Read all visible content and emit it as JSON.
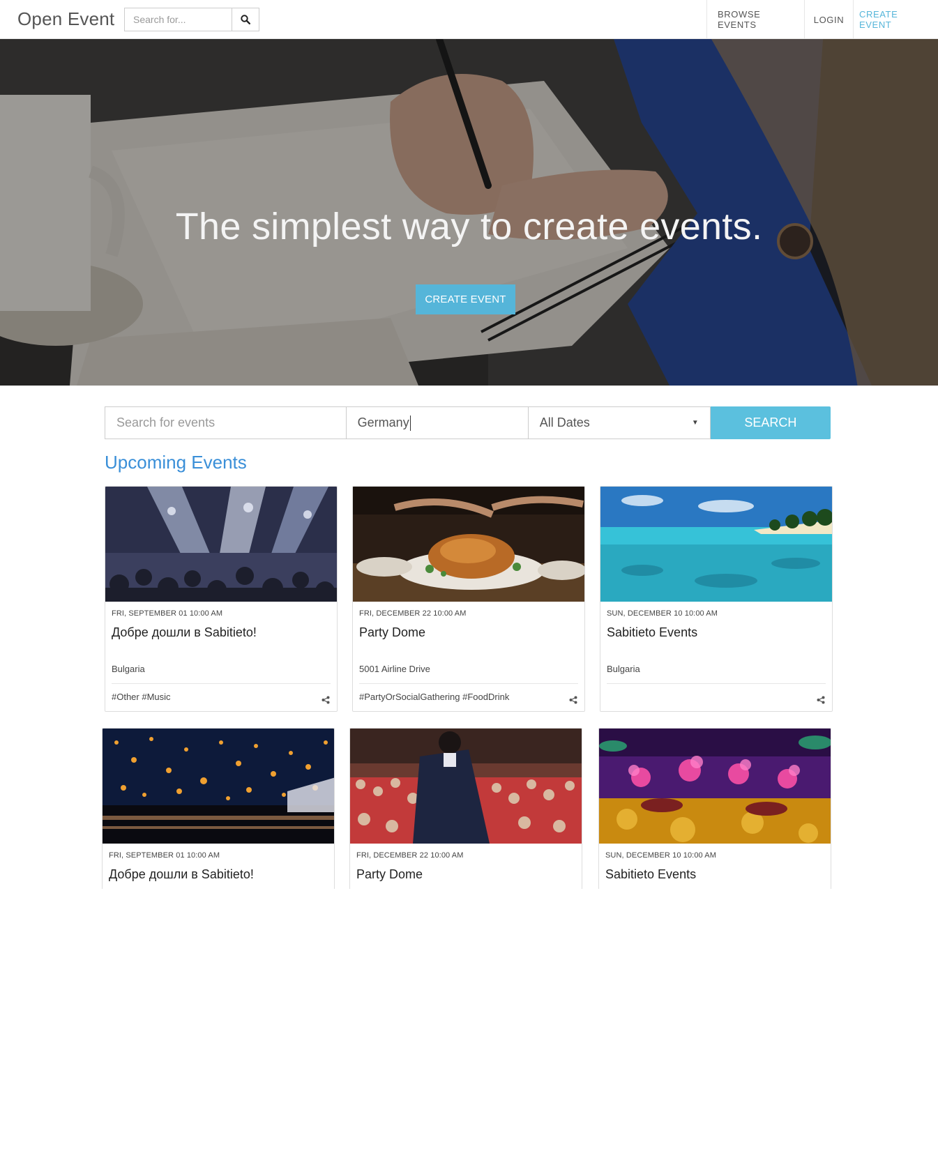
{
  "brand": "Open Event",
  "nav_search": {
    "placeholder": "Search for..."
  },
  "nav": [
    {
      "label": "BROWSE EVENTS"
    },
    {
      "label": "LOGIN"
    },
    {
      "label": "CREATE EVENT"
    }
  ],
  "hero": {
    "title": "The simplest way to create events.",
    "button": "CREATE EVENT"
  },
  "search": {
    "keyword_placeholder": "Search for events",
    "location_value": "Germany",
    "dates_value": "All Dates",
    "button": "SEARCH"
  },
  "section_title": "Upcoming Events",
  "events": [
    {
      "date": "FRI, SEPTEMBER 01 10:00 AM",
      "title": "Добре дошли в Sabitieto!",
      "location": "Bulgaria",
      "tags": "#Other #Music"
    },
    {
      "date": "FRI, DECEMBER 22 10:00 AM",
      "title": "Party Dome",
      "location": "5001 Airline Drive",
      "tags": "#PartyOrSocialGathering #FoodDrink"
    },
    {
      "date": "SUN, DECEMBER 10 10:00 AM",
      "title": "Sabitieto Events",
      "location": "Bulgaria",
      "tags": ""
    },
    {
      "date": "FRI, SEPTEMBER 01 10:00 AM",
      "title": "Добре дошли в Sabitieto!"
    },
    {
      "date": "FRI, DECEMBER 22 10:00 AM",
      "title": "Party Dome"
    },
    {
      "date": "SUN, DECEMBER 10 10:00 AM",
      "title": "Sabitieto Events"
    }
  ],
  "colors": {
    "accent": "#55b5d9",
    "search_button": "#5bc0de",
    "section_title": "#3a8fd8"
  },
  "icons": {
    "nav_search": "search-icon",
    "share": "share-icon"
  }
}
